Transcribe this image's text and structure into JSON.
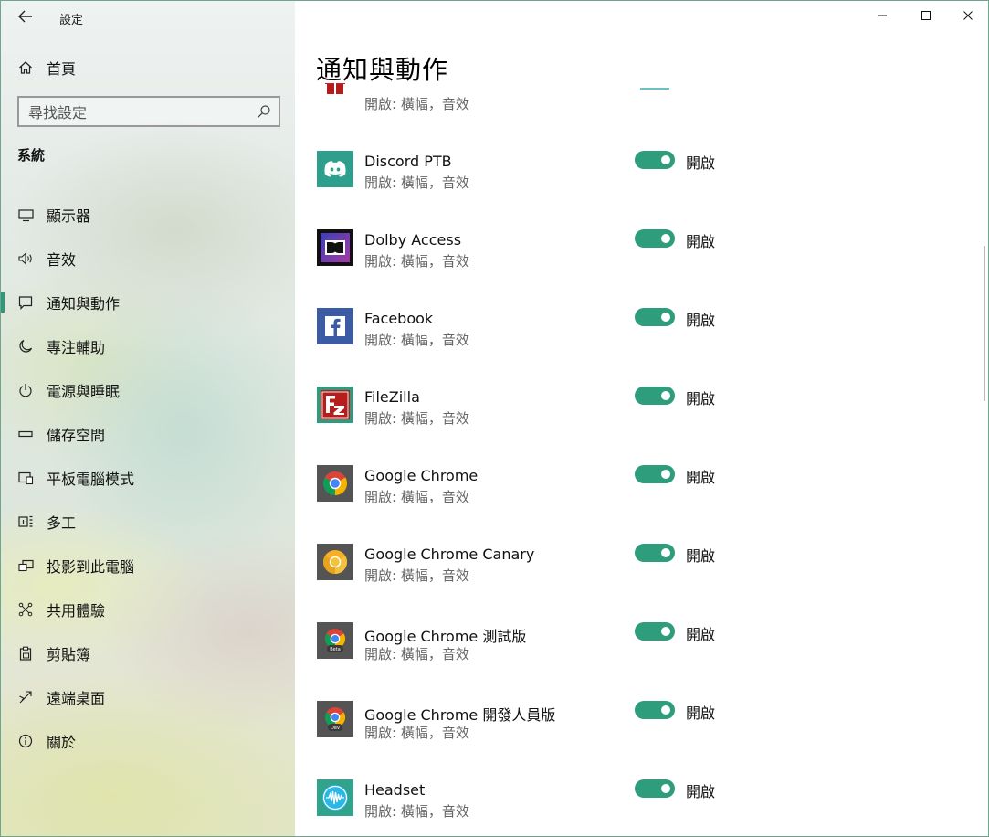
{
  "window": {
    "title": "設定",
    "controls": {
      "minimize": "–",
      "maximize": "☐",
      "close": "✕"
    }
  },
  "sidebar": {
    "home_label": "首頁",
    "search_placeholder": "尋找設定",
    "section_title": "系統",
    "items": [
      {
        "label": "顯示器",
        "icon": "monitor-icon"
      },
      {
        "label": "音效",
        "icon": "speaker-icon"
      },
      {
        "label": "通知與動作",
        "icon": "notification-icon",
        "active": true
      },
      {
        "label": "專注輔助",
        "icon": "moon-icon"
      },
      {
        "label": "電源與睡眠",
        "icon": "power-icon"
      },
      {
        "label": "儲存空間",
        "icon": "storage-icon"
      },
      {
        "label": "平板電腦模式",
        "icon": "tablet-icon"
      },
      {
        "label": "多工",
        "icon": "multitask-icon"
      },
      {
        "label": "投影到此電腦",
        "icon": "projection-icon"
      },
      {
        "label": "共用體驗",
        "icon": "shared-experience-icon"
      },
      {
        "label": "剪貼簿",
        "icon": "clipboard-icon"
      },
      {
        "label": "遠端桌面",
        "icon": "remote-desktop-icon"
      },
      {
        "label": "關於",
        "icon": "info-icon"
      }
    ]
  },
  "main": {
    "page_title": "通知與動作",
    "partial_row": {
      "subtitle": "開啟: 橫幅，音效",
      "icon": "gift-app-icon"
    },
    "apps": [
      {
        "name": "Discord PTB",
        "subtitle": "開啟: 橫幅，音效",
        "toggle_label": "開啟",
        "icon": "discord-icon"
      },
      {
        "name": "Dolby Access",
        "subtitle": "開啟: 橫幅，音效",
        "toggle_label": "開啟",
        "icon": "dolby-icon"
      },
      {
        "name": "Facebook",
        "subtitle": "開啟: 橫幅，音效",
        "toggle_label": "開啟",
        "icon": "facebook-icon"
      },
      {
        "name": "FileZilla",
        "subtitle": "開啟: 橫幅，音效",
        "toggle_label": "開啟",
        "icon": "filezilla-icon"
      },
      {
        "name": "Google Chrome",
        "subtitle": "開啟: 橫幅，音效",
        "toggle_label": "開啟",
        "icon": "chrome-icon"
      },
      {
        "name": "Google Chrome Canary",
        "subtitle": "開啟: 橫幅，音效",
        "toggle_label": "開啟",
        "icon": "chrome-canary-icon"
      },
      {
        "name": "Google Chrome 測試版",
        "subtitle": "開啟: 橫幅，音效",
        "toggle_label": "開啟",
        "icon": "chrome-beta-icon",
        "badge": "Beta"
      },
      {
        "name": "Google Chrome 開發人員版",
        "subtitle": "開啟: 橫幅，音效",
        "toggle_label": "開啟",
        "icon": "chrome-dev-icon",
        "badge": "Dev"
      },
      {
        "name": "Headset",
        "subtitle": "開啟: 橫幅，音效",
        "toggle_label": "開啟",
        "icon": "headset-icon"
      }
    ]
  },
  "colors": {
    "accent": "#2e9d7b",
    "subtitle": "#666666"
  }
}
